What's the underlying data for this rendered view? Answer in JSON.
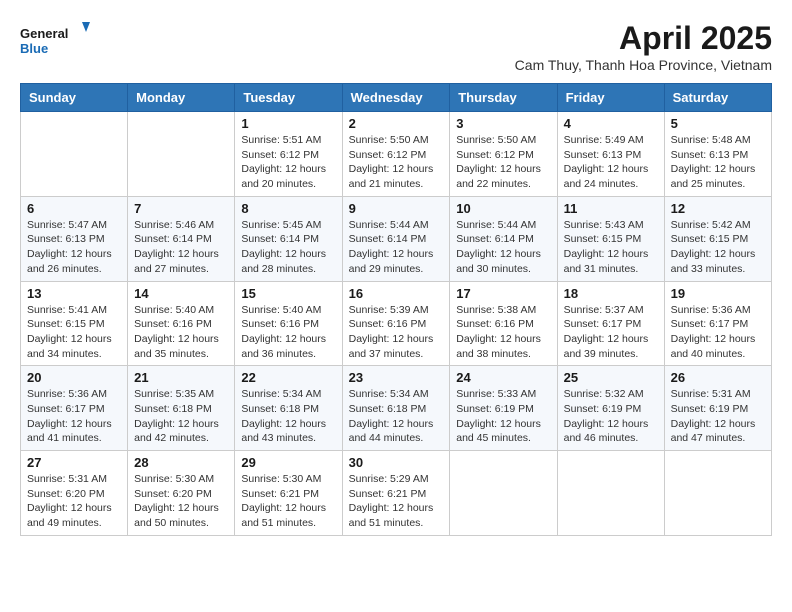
{
  "header": {
    "logo_line1": "General",
    "logo_line2": "Blue",
    "month_title": "April 2025",
    "subtitle": "Cam Thuy, Thanh Hoa Province, Vietnam"
  },
  "weekdays": [
    "Sunday",
    "Monday",
    "Tuesday",
    "Wednesday",
    "Thursday",
    "Friday",
    "Saturday"
  ],
  "weeks": [
    [
      {
        "day": "",
        "info": ""
      },
      {
        "day": "",
        "info": ""
      },
      {
        "day": "1",
        "info": "Sunrise: 5:51 AM\nSunset: 6:12 PM\nDaylight: 12 hours and 20 minutes."
      },
      {
        "day": "2",
        "info": "Sunrise: 5:50 AM\nSunset: 6:12 PM\nDaylight: 12 hours and 21 minutes."
      },
      {
        "day": "3",
        "info": "Sunrise: 5:50 AM\nSunset: 6:12 PM\nDaylight: 12 hours and 22 minutes."
      },
      {
        "day": "4",
        "info": "Sunrise: 5:49 AM\nSunset: 6:13 PM\nDaylight: 12 hours and 24 minutes."
      },
      {
        "day": "5",
        "info": "Sunrise: 5:48 AM\nSunset: 6:13 PM\nDaylight: 12 hours and 25 minutes."
      }
    ],
    [
      {
        "day": "6",
        "info": "Sunrise: 5:47 AM\nSunset: 6:13 PM\nDaylight: 12 hours and 26 minutes."
      },
      {
        "day": "7",
        "info": "Sunrise: 5:46 AM\nSunset: 6:14 PM\nDaylight: 12 hours and 27 minutes."
      },
      {
        "day": "8",
        "info": "Sunrise: 5:45 AM\nSunset: 6:14 PM\nDaylight: 12 hours and 28 minutes."
      },
      {
        "day": "9",
        "info": "Sunrise: 5:44 AM\nSunset: 6:14 PM\nDaylight: 12 hours and 29 minutes."
      },
      {
        "day": "10",
        "info": "Sunrise: 5:44 AM\nSunset: 6:14 PM\nDaylight: 12 hours and 30 minutes."
      },
      {
        "day": "11",
        "info": "Sunrise: 5:43 AM\nSunset: 6:15 PM\nDaylight: 12 hours and 31 minutes."
      },
      {
        "day": "12",
        "info": "Sunrise: 5:42 AM\nSunset: 6:15 PM\nDaylight: 12 hours and 33 minutes."
      }
    ],
    [
      {
        "day": "13",
        "info": "Sunrise: 5:41 AM\nSunset: 6:15 PM\nDaylight: 12 hours and 34 minutes."
      },
      {
        "day": "14",
        "info": "Sunrise: 5:40 AM\nSunset: 6:16 PM\nDaylight: 12 hours and 35 minutes."
      },
      {
        "day": "15",
        "info": "Sunrise: 5:40 AM\nSunset: 6:16 PM\nDaylight: 12 hours and 36 minutes."
      },
      {
        "day": "16",
        "info": "Sunrise: 5:39 AM\nSunset: 6:16 PM\nDaylight: 12 hours and 37 minutes."
      },
      {
        "day": "17",
        "info": "Sunrise: 5:38 AM\nSunset: 6:16 PM\nDaylight: 12 hours and 38 minutes."
      },
      {
        "day": "18",
        "info": "Sunrise: 5:37 AM\nSunset: 6:17 PM\nDaylight: 12 hours and 39 minutes."
      },
      {
        "day": "19",
        "info": "Sunrise: 5:36 AM\nSunset: 6:17 PM\nDaylight: 12 hours and 40 minutes."
      }
    ],
    [
      {
        "day": "20",
        "info": "Sunrise: 5:36 AM\nSunset: 6:17 PM\nDaylight: 12 hours and 41 minutes."
      },
      {
        "day": "21",
        "info": "Sunrise: 5:35 AM\nSunset: 6:18 PM\nDaylight: 12 hours and 42 minutes."
      },
      {
        "day": "22",
        "info": "Sunrise: 5:34 AM\nSunset: 6:18 PM\nDaylight: 12 hours and 43 minutes."
      },
      {
        "day": "23",
        "info": "Sunrise: 5:34 AM\nSunset: 6:18 PM\nDaylight: 12 hours and 44 minutes."
      },
      {
        "day": "24",
        "info": "Sunrise: 5:33 AM\nSunset: 6:19 PM\nDaylight: 12 hours and 45 minutes."
      },
      {
        "day": "25",
        "info": "Sunrise: 5:32 AM\nSunset: 6:19 PM\nDaylight: 12 hours and 46 minutes."
      },
      {
        "day": "26",
        "info": "Sunrise: 5:31 AM\nSunset: 6:19 PM\nDaylight: 12 hours and 47 minutes."
      }
    ],
    [
      {
        "day": "27",
        "info": "Sunrise: 5:31 AM\nSunset: 6:20 PM\nDaylight: 12 hours and 49 minutes."
      },
      {
        "day": "28",
        "info": "Sunrise: 5:30 AM\nSunset: 6:20 PM\nDaylight: 12 hours and 50 minutes."
      },
      {
        "day": "29",
        "info": "Sunrise: 5:30 AM\nSunset: 6:21 PM\nDaylight: 12 hours and 51 minutes."
      },
      {
        "day": "30",
        "info": "Sunrise: 5:29 AM\nSunset: 6:21 PM\nDaylight: 12 hours and 51 minutes."
      },
      {
        "day": "",
        "info": ""
      },
      {
        "day": "",
        "info": ""
      },
      {
        "day": "",
        "info": ""
      }
    ]
  ]
}
